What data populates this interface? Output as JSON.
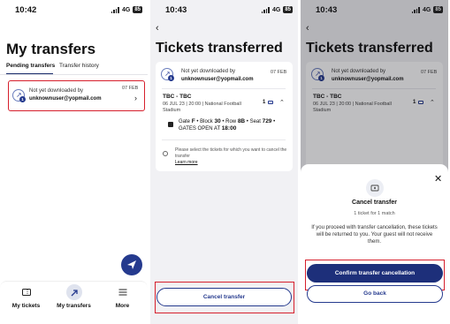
{
  "screen1": {
    "status": {
      "time": "10:42",
      "network": "4G",
      "battery": "85"
    },
    "title": "My transfers",
    "tabs": [
      {
        "label": "Pending transfers",
        "active": true
      },
      {
        "label": "Transfer history",
        "active": false
      }
    ],
    "transfer": {
      "status": "Not yet downloaded by",
      "email": "unknownuser@yopmail.com",
      "date": "07 FEB",
      "badge": "1"
    },
    "nav": [
      {
        "label": "My tickets",
        "icon": "ticket-icon"
      },
      {
        "label": "My transfers",
        "icon": "transfer-icon",
        "active": true
      },
      {
        "label": "More",
        "icon": "menu-icon"
      }
    ]
  },
  "screen2": {
    "status": {
      "time": "10:43",
      "network": "4G",
      "battery": "85"
    },
    "title": "Tickets transferred",
    "transfer": {
      "status": "Not yet downloaded by",
      "email": "unknownuser@yopmail.com",
      "date": "07 FEB",
      "badge": "1"
    },
    "match": {
      "teams": "TBC - TBC",
      "details": "06 JUL 23 | 20:00 | National Football",
      "venue": "Stadium",
      "quantity": "1"
    },
    "seat": {
      "gate_label": "Gate",
      "gate": "F",
      "block_label": "Block",
      "block": "30",
      "row_label": "Row",
      "row": "8B",
      "seat_label": "Seat",
      "seat": "729",
      "gates_open_label": "GATES OPEN AT",
      "gates_open": "18:00"
    },
    "note": "Please select the tickets for which you want to cancel the transfer",
    "learn_more": "Learn more",
    "cancel_button": "Cancel transfer"
  },
  "screen3": {
    "status": {
      "time": "10:43",
      "network": "4G",
      "battery": "85"
    },
    "title": "Tickets transferred",
    "transfer": {
      "status": "Not yet downloaded by",
      "email": "unknownuser@yopmail.com",
      "date": "07 FEB",
      "badge": "1"
    },
    "match": {
      "teams": "TBC - TBC",
      "details": "06 JUL 23 | 20:00 | National Football",
      "venue": "Stadium",
      "quantity": "1"
    },
    "sheet": {
      "title": "Cancel transfer",
      "subtitle": "1 ticket for 1 match",
      "body": "If you proceed with transfer cancellation, these tickets will be returned to you. Your guest will not receive them.",
      "confirm_button": "Confirm transfer cancellation",
      "back_button": "Go back"
    }
  },
  "colors": {
    "accent": "#253a8e",
    "highlight": "#d61f2c"
  }
}
